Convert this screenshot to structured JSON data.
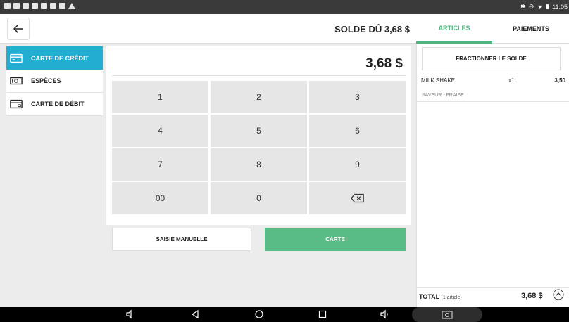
{
  "header": {
    "balance_due": "SOLDE DÛ 3,68 $",
    "tabs": [
      {
        "label": "ARTICLES",
        "active": true
      },
      {
        "label": "PAIEMENTS",
        "active": false
      }
    ]
  },
  "payment_methods": [
    {
      "label": "CARTE DE CRÉDIT",
      "icon": "credit-card-icon",
      "active": true
    },
    {
      "label": "ESPÈCES",
      "icon": "cash-icon",
      "active": false
    },
    {
      "label": "CARTE DE DÉBIT",
      "icon": "debit-card-icon",
      "active": false
    }
  ],
  "keypad": {
    "amount": "3,68 $",
    "keys": [
      "1",
      "2",
      "3",
      "4",
      "5",
      "6",
      "7",
      "8",
      "9",
      "00",
      "0"
    ]
  },
  "actions": {
    "manual_entry": "SAISIE MANUELLE",
    "card": "CARTE"
  },
  "order": {
    "split_label": "FRACTIONNER LE SOLDE",
    "items": [
      {
        "name": "MILK SHAKE",
        "qty": "x1",
        "price": "3,50",
        "modifier": "SAVEUR - FRAISE"
      }
    ],
    "total_label": "TOTAL",
    "total_count": "(1 article)",
    "total_value": "3,68 $"
  },
  "status_bar": {
    "time": "11:05"
  },
  "colors": {
    "accent_blue": "#22aed1",
    "accent_green": "#59bb86",
    "tab_green": "#4fb47e"
  }
}
